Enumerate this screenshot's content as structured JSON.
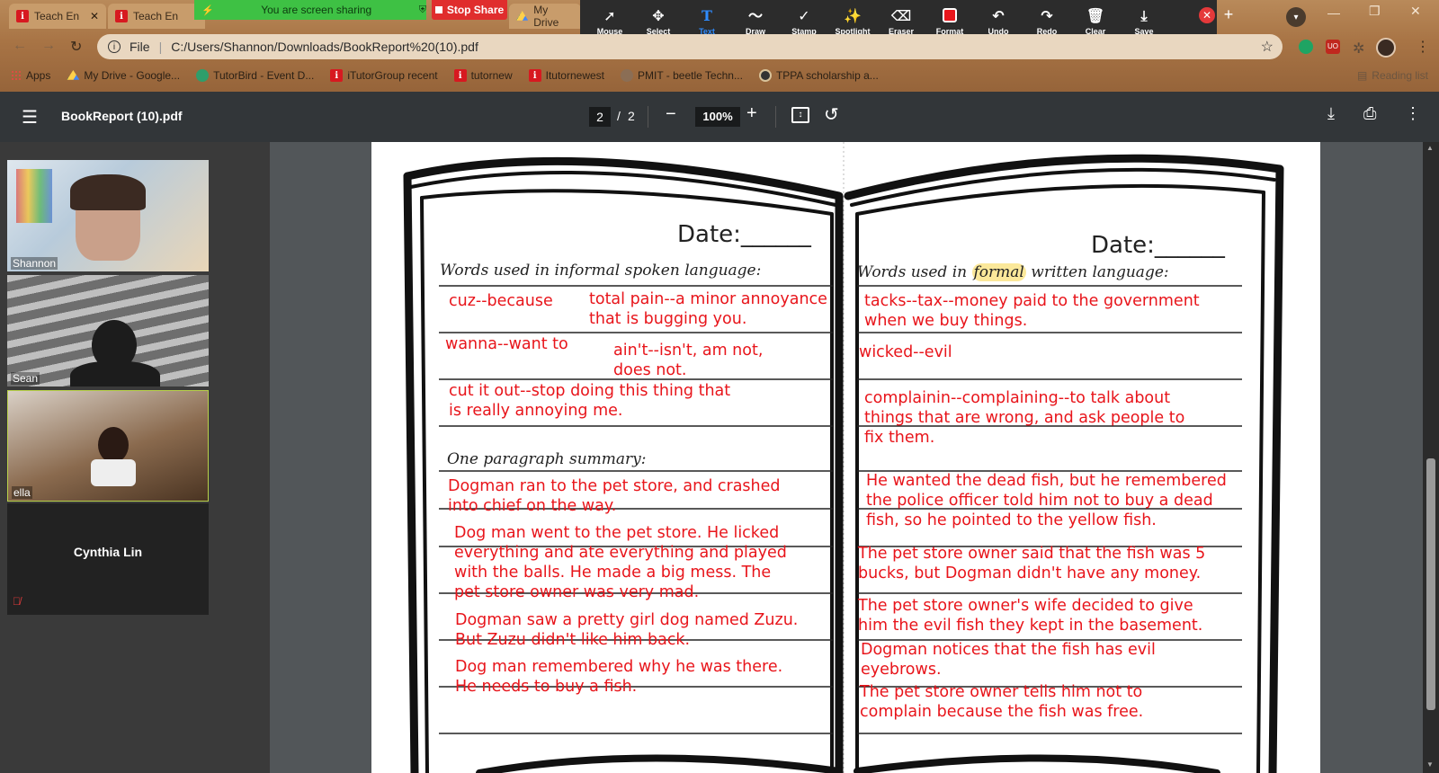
{
  "browser": {
    "tabs": [
      {
        "label": "Teach En"
      },
      {
        "label": "Teach En"
      },
      {
        "label": "My Drive"
      }
    ],
    "address": {
      "scheme_label": "File",
      "url": "C:/Users/Shannon/Downloads/BookReport%20(10).pdf"
    },
    "bookmarks": [
      "Apps",
      "My Drive - Google...",
      "TutorBird - Event D...",
      "iTutorGroup recent",
      "tutornew",
      "Itutornewest",
      "PMIT - beetle Techn...",
      "TPPA scholarship a..."
    ],
    "reading_list": "Reading list"
  },
  "zoom_share": {
    "banner": "You are screen sharing",
    "stop_label": "Stop Share",
    "tools": [
      {
        "icon": "mouse-pointer-icon",
        "label": "Mouse"
      },
      {
        "icon": "select-icon",
        "label": "Select"
      },
      {
        "icon": "text-icon",
        "label": "Text"
      },
      {
        "icon": "draw-icon",
        "label": "Draw"
      },
      {
        "icon": "stamp-icon",
        "label": "Stamp"
      },
      {
        "icon": "spotlight-icon",
        "label": "Spotlight"
      },
      {
        "icon": "eraser-icon",
        "label": "Eraser"
      },
      {
        "icon": "format-icon",
        "label": "Format"
      },
      {
        "icon": "undo-icon",
        "label": "Undo"
      },
      {
        "icon": "redo-icon",
        "label": "Redo"
      },
      {
        "icon": "clear-icon",
        "label": "Clear"
      },
      {
        "icon": "save-icon",
        "label": "Save"
      }
    ],
    "active_tool": "Text",
    "format_color": "#e8151b"
  },
  "pdf_viewer": {
    "title": "BookReport (10).pdf",
    "page_current": "2",
    "page_sep": "/",
    "page_total": "2",
    "zoom": "100%"
  },
  "participants": [
    {
      "name": "Shannon"
    },
    {
      "name": "Sean"
    },
    {
      "name": "ella"
    },
    {
      "name": "Cynthia Lin"
    }
  ],
  "worksheet": {
    "left": {
      "date_label": "Date:______",
      "heading": "Words used in informal spoken language:",
      "summary_heading": "One paragraph summary:"
    },
    "right": {
      "date_label": "Date:______",
      "heading_pre": "Words used in ",
      "heading_highlight": "formal",
      "heading_post": " written language:"
    }
  },
  "annotations": {
    "left": [
      "cuz--because",
      "total pain--a minor annoyance\nthat is bugging you.",
      "wanna--want to",
      "ain't--isn't, am not,\ndoes not.",
      "cut it out--stop doing this thing that\nis really annoying me.",
      "Dogman ran to the pet store, and crashed\ninto chief on the way.",
      "Dog man went to the pet store.  He licked\neverything and ate everything and played\nwith the balls. He made a big mess. The\npet store owner was very mad.",
      "Dogman saw a pretty girl dog named Zuzu.\nBut Zuzu didn't like him back.",
      "Dog man remembered why he was there.\nHe needs to buy a fish."
    ],
    "right": [
      "tacks--tax--money paid to the government\nwhen we buy things.",
      "wicked--evil",
      "complainin--complaining--to talk about\nthings that are wrong, and ask people to\nfix them.",
      "He wanted the dead fish, but he remembered\nthe police officer told him not to buy a dead\nfish, so he pointed to the yellow fish.",
      "The pet store owner said that the fish was 5\nbucks, but Dogman didn't have any money.",
      "The pet store owner's wife decided to give\nhim the evil fish they kept in the basement.",
      "Dogman notices that the fish has evil\neyebrows.",
      "The pet store owner tells him not to\ncomplain   because the fish was free."
    ]
  }
}
